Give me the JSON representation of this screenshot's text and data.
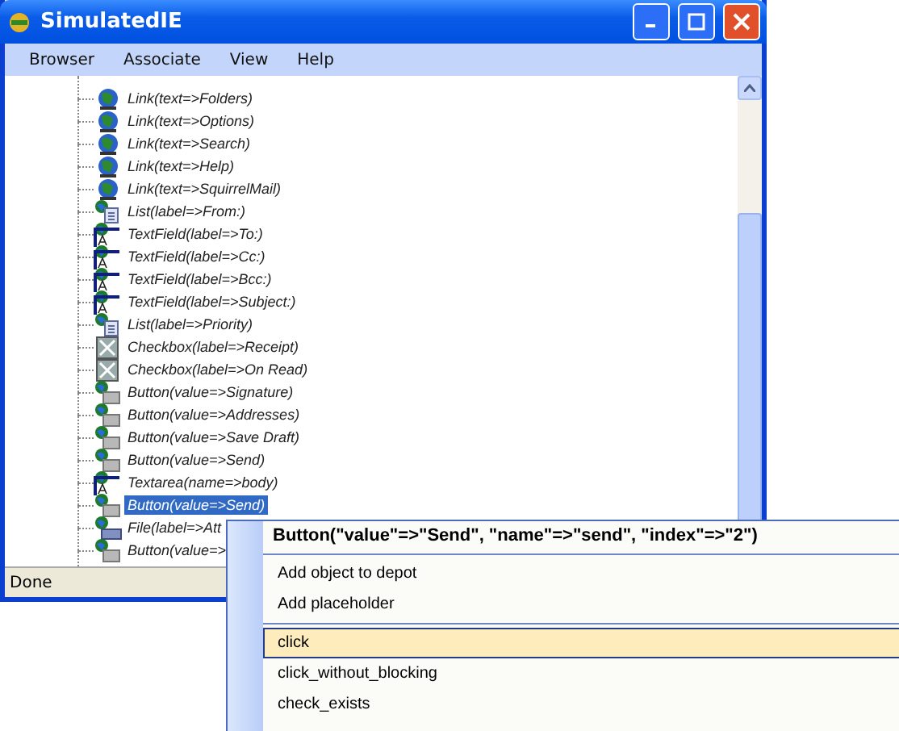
{
  "window": {
    "title": "SimulatedIE"
  },
  "menu": [
    "Browser",
    "Associate",
    "View",
    "Help"
  ],
  "tree": [
    {
      "kind": "link",
      "label": "Link(text=>Folders)",
      "selected": false
    },
    {
      "kind": "link",
      "label": "Link(text=>Options)",
      "selected": false
    },
    {
      "kind": "link",
      "label": "Link(text=>Search)",
      "selected": false
    },
    {
      "kind": "link",
      "label": "Link(text=>Help)",
      "selected": false
    },
    {
      "kind": "link",
      "label": "Link(text=>SquirrelMail)",
      "selected": false
    },
    {
      "kind": "list",
      "label": "List(label=>From:)",
      "selected": false
    },
    {
      "kind": "textfield",
      "label": "TextField(label=>To:)",
      "selected": false
    },
    {
      "kind": "textfield",
      "label": "TextField(label=>Cc:)",
      "selected": false
    },
    {
      "kind": "textfield",
      "label": "TextField(label=>Bcc:)",
      "selected": false
    },
    {
      "kind": "textfield",
      "label": "TextField(label=>Subject:)",
      "selected": false
    },
    {
      "kind": "list",
      "label": "List(label=>Priority)",
      "selected": false
    },
    {
      "kind": "checkbox",
      "label": "Checkbox(label=>Receipt)",
      "selected": false
    },
    {
      "kind": "checkbox",
      "label": "Checkbox(label=>On Read)",
      "selected": false
    },
    {
      "kind": "button",
      "label": "Button(value=>Signature)",
      "selected": false
    },
    {
      "kind": "button",
      "label": "Button(value=>Addresses)",
      "selected": false
    },
    {
      "kind": "button",
      "label": "Button(value=>Save Draft)",
      "selected": false
    },
    {
      "kind": "button",
      "label": "Button(value=>Send)",
      "selected": false
    },
    {
      "kind": "textarea",
      "label": "Textarea(name=>body)",
      "selected": false
    },
    {
      "kind": "button",
      "label": "Button(value=>Send)",
      "selected": true
    },
    {
      "kind": "file",
      "label": "File(label=>Att",
      "selected": false
    },
    {
      "kind": "button",
      "label": "Button(value=>",
      "selected": false
    }
  ],
  "status_bar": "Done",
  "context_menu": {
    "title": "Button(\"value\"=>\"Send\", \"name\"=>\"send\", \"index\"=>\"2\")",
    "groups": [
      [
        {
          "label": "Add object to depot",
          "selected": false
        },
        {
          "label": "Add placeholder",
          "selected": false
        }
      ],
      [
        {
          "label": "click",
          "selected": true
        },
        {
          "label": "click_without_blocking",
          "selected": false
        },
        {
          "label": "check_exists",
          "selected": false
        }
      ]
    ]
  }
}
